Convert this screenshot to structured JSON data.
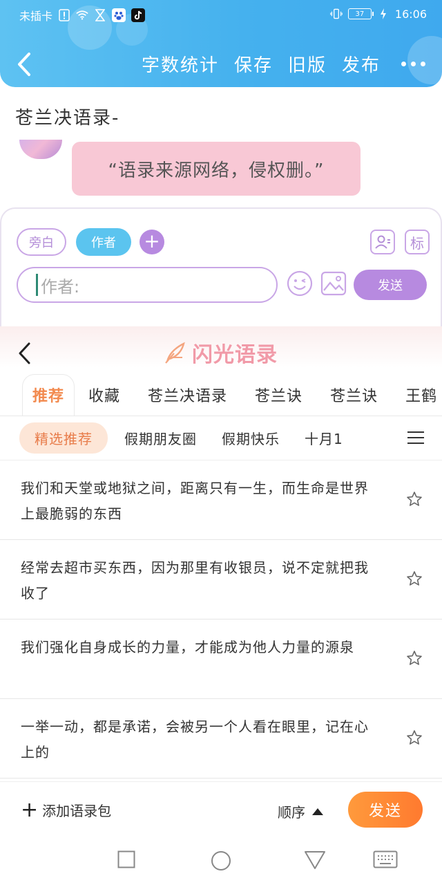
{
  "status_bar": {
    "carrier": "未插卡",
    "battery": "37",
    "time": "16:06"
  },
  "header": {
    "actions": [
      "字数统计",
      "保存",
      "旧版",
      "发布"
    ]
  },
  "chat": {
    "title": "苍兰决语录-",
    "message": "“语录来源网络，侵权删。”"
  },
  "composer": {
    "tag_narration": "旁白",
    "tag_author": "作者",
    "tag_icon_label": "标",
    "author_placeholder": "作者:",
    "send_label": "发送"
  },
  "sheet": {
    "brand_title": "闪光语录",
    "tabs": [
      "推荐",
      "收藏",
      "苍兰决语录",
      "苍兰诀",
      "苍兰诀",
      "王鹤"
    ],
    "subtabs": [
      "精选推荐",
      "假期朋友圈",
      "假期快乐",
      "十月1"
    ],
    "quotes": [
      "我们和天堂或地狱之间，距离只有一生，而生命是世界上最脆弱的东西",
      "经常去超市买东西，因为那里有收银员，说不定就把我收了",
      "我们强化自身成长的力量，才能成为他人力量的源泉",
      "一举一动，都是承诺，会被另一个人看在眼里，记在心上的"
    ]
  },
  "bottom": {
    "add_pack": "添加语录包",
    "order": "顺序",
    "send": "发送"
  },
  "colors": {
    "header_blue": "#45b1ee",
    "accent_purple": "#b78ae0",
    "accent_orange": "#ff8a35",
    "bubble_pink": "#f8c8d5"
  }
}
